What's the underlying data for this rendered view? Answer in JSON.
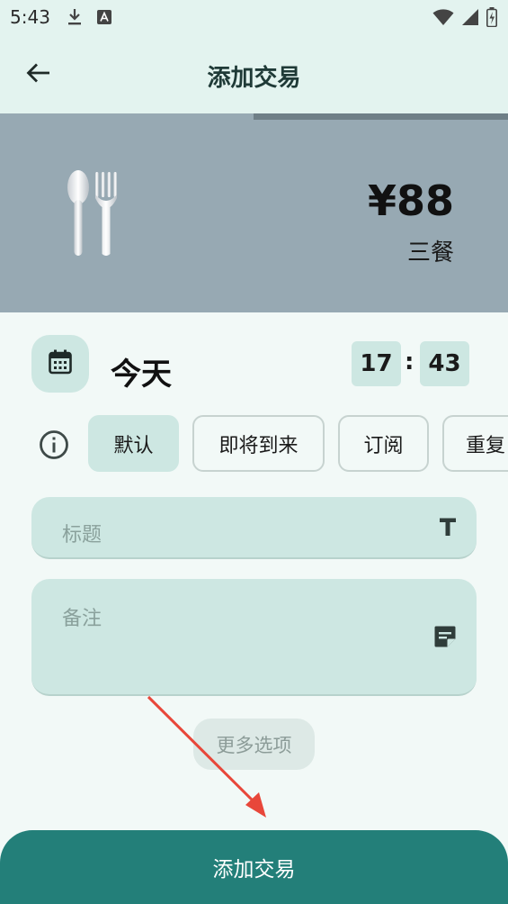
{
  "status_bar": {
    "time": "5:43",
    "icons": [
      "download-icon",
      "a-text-icon",
      "wifi-icon",
      "signal-icon",
      "battery-icon"
    ]
  },
  "app_bar": {
    "title": "添加交易",
    "back_icon": "arrow-left-icon"
  },
  "hero": {
    "amount": "¥88",
    "category": "三餐",
    "icon": "spoon-fork-icon",
    "background_color": "#97a9b3"
  },
  "datetime": {
    "date_label": "今天",
    "hour": "17",
    "separator": ":",
    "minute": "43"
  },
  "type_chips": [
    {
      "label": "默认",
      "selected": true
    },
    {
      "label": "即将到来",
      "selected": false
    },
    {
      "label": "订阅",
      "selected": false
    },
    {
      "label": "重复",
      "selected": false
    }
  ],
  "fields": {
    "title_placeholder": "标题",
    "notes_placeholder": "备注"
  },
  "more_options_label": "更多选项",
  "submit_label": "添加交易",
  "colors": {
    "accent": "#237f79",
    "field_bg": "#cde7e2",
    "app_bar_bg": "#e3f3ef",
    "annotation_arrow": "#e8473a"
  }
}
